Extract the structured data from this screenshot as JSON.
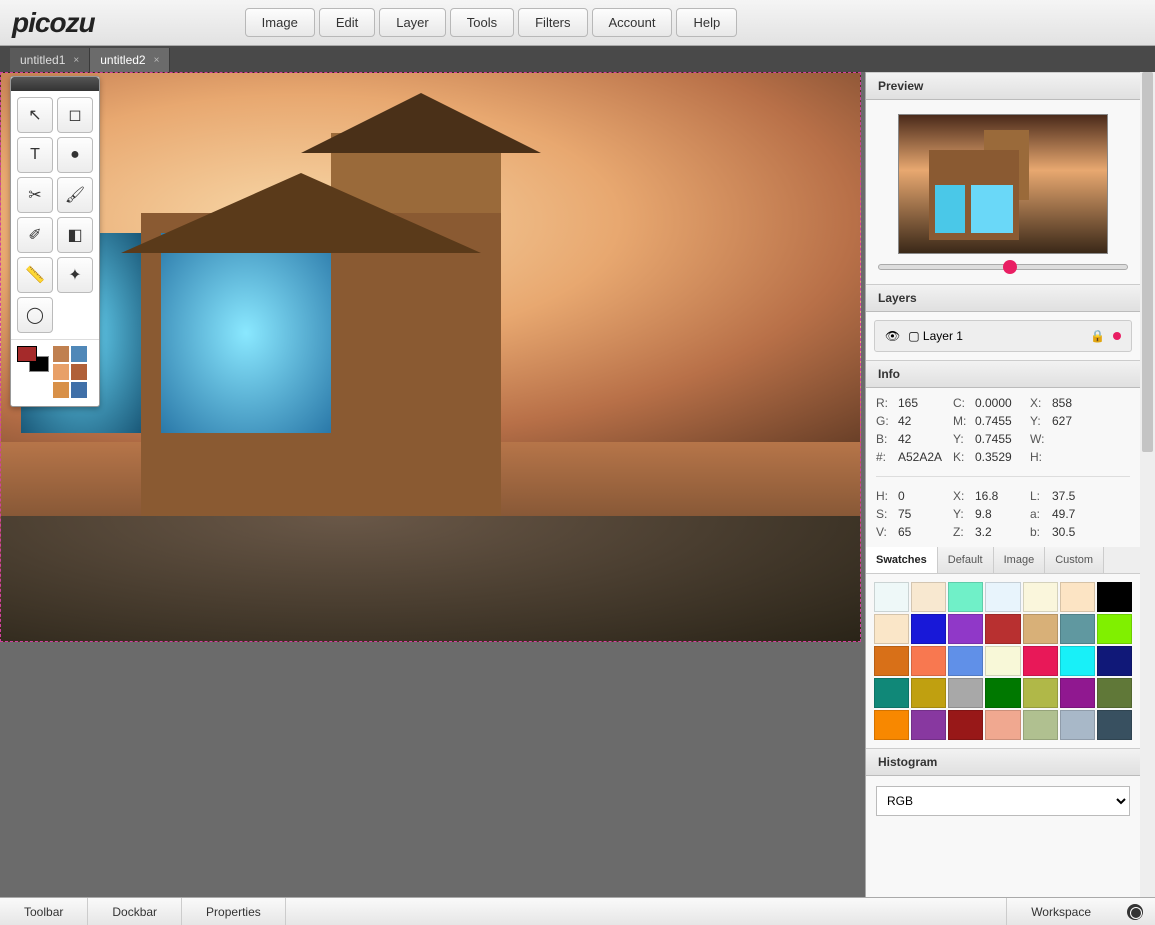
{
  "app": {
    "logo": "picozu"
  },
  "menu": [
    "Image",
    "Edit",
    "Layer",
    "Tools",
    "Filters",
    "Account",
    "Help"
  ],
  "tabs": [
    {
      "label": "untitled1",
      "active": false
    },
    {
      "label": "untitled2",
      "active": true
    }
  ],
  "tools": [
    {
      "name": "pointer",
      "glyph": "↖"
    },
    {
      "name": "marquee",
      "glyph": "◻"
    },
    {
      "name": "text",
      "glyph": "T"
    },
    {
      "name": "smudge",
      "glyph": "●"
    },
    {
      "name": "crop",
      "glyph": "✂"
    },
    {
      "name": "brush",
      "glyph": "🖌"
    },
    {
      "name": "eyedrop",
      "glyph": "✐"
    },
    {
      "name": "eraser",
      "glyph": "◧"
    },
    {
      "name": "ruler",
      "glyph": "📏"
    },
    {
      "name": "pattern",
      "glyph": "✦"
    },
    {
      "name": "spray",
      "glyph": "◯"
    }
  ],
  "palette_mini": {
    "fg": "#a52a2a",
    "bg": "#000000",
    "rows": [
      [
        "#c08050",
        "#5088b8"
      ],
      [
        "#e8a068",
        "#b06038"
      ],
      [
        "#d89048",
        "#4070a8"
      ]
    ]
  },
  "panels": {
    "preview": "Preview",
    "layers": "Layers",
    "info": "Info",
    "swatches": "Swatches",
    "histogram": "Histogram"
  },
  "layers": [
    {
      "name": "Layer 1",
      "visible": true
    }
  ],
  "info": {
    "R": "165",
    "G": "42",
    "B": "42",
    "hex": "A52A2A",
    "C": "0.0000",
    "M": "0.7455",
    "Yc": "0.7455",
    "K": "0.3529",
    "Xpx": "858",
    "Ypx": "627",
    "W": "",
    "H": "",
    "Hh": "0",
    "S": "75",
    "V": "65",
    "Xx": "16.8",
    "Yy": "9.8",
    "Z": "3.2",
    "L": "37.5",
    "a": "49.7",
    "b": "30.5"
  },
  "swatch_tabs": [
    "Swatches",
    "Default",
    "Image",
    "Custom"
  ],
  "swatches": [
    "#eef8f8",
    "#f8e8d0",
    "#70f0c8",
    "#e8f4fc",
    "#faf6dc",
    "#fce4c4",
    "#000000",
    "#fae6c8",
    "#1818d8",
    "#9038c8",
    "#b83030",
    "#d8b078",
    "#6098a0",
    "#80f000",
    "#d87018",
    "#f87850",
    "#6090e8",
    "#f8f8d8",
    "#e81858",
    "#18f0f8",
    "#101878",
    "#108878",
    "#c0a010",
    "#a8a8a8",
    "#007800",
    "#b0b848",
    "#901890",
    "#607838",
    "#f88800",
    "#8838a0",
    "#981818",
    "#f0a890",
    "#b0c090",
    "#a8b8c8",
    "#385060"
  ],
  "histogram": {
    "mode": "RGB"
  },
  "bottombar": [
    "Toolbar",
    "Dockbar",
    "Properties"
  ],
  "workspace_label": "Workspace"
}
